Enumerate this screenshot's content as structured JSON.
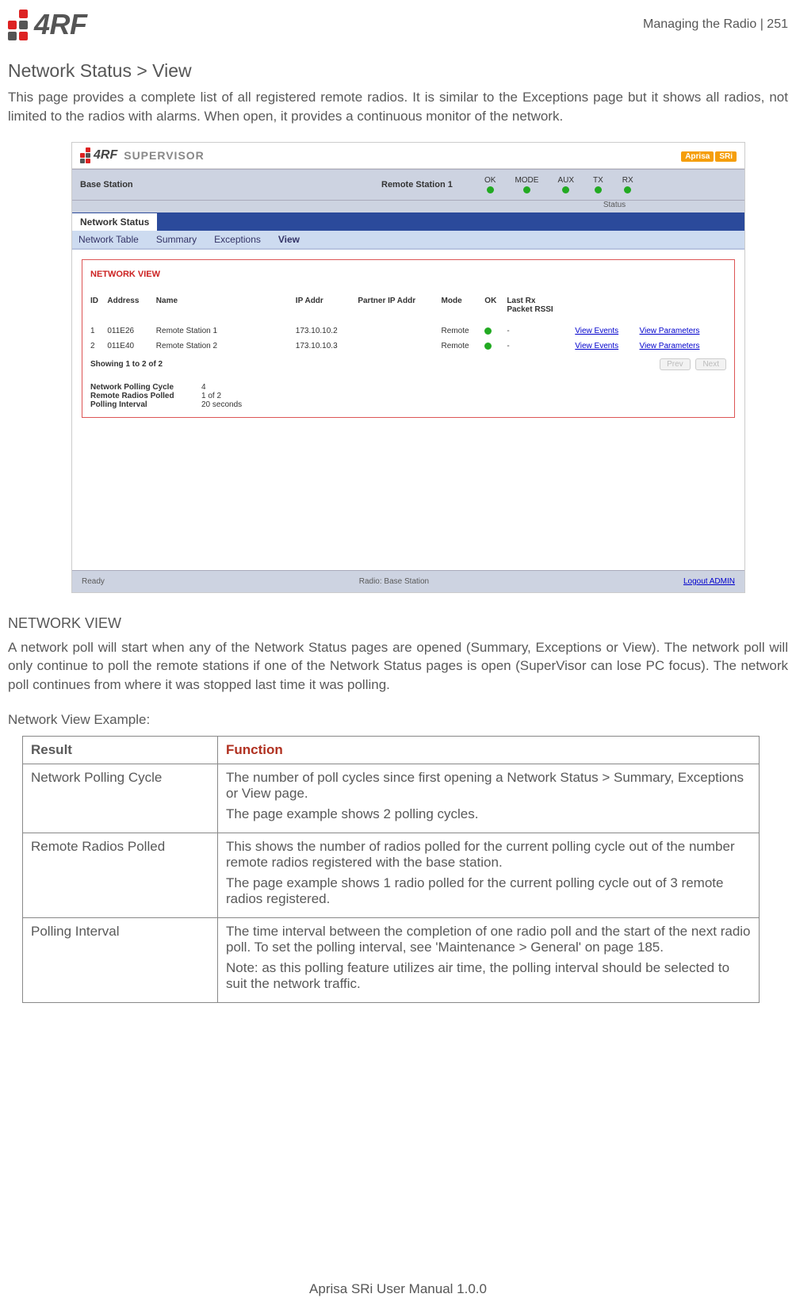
{
  "header": {
    "logo_text": "4RF",
    "right": "Managing the Radio  |  251"
  },
  "section": {
    "title": "Network Status > View",
    "intro": "This page provides a complete list of all registered remote radios. It is similar to the Exceptions page but it shows all radios, not limited to the radios with alarms. When open, it provides a continuous monitor of the network."
  },
  "supervisor": {
    "logo_text": "4RF",
    "sup": "SUPERVISOR",
    "brand": "Aprisa",
    "brand_badge": "SRi",
    "base": "Base Station",
    "remote": "Remote Station 1",
    "leds": [
      "OK",
      "MODE",
      "AUX",
      "TX",
      "RX"
    ],
    "status_label": "Status",
    "tab": "Network Status",
    "subtabs": {
      "a": "Network Table",
      "b": "Summary",
      "c": "Exceptions",
      "d": "View"
    },
    "panel_title": "NETWORK VIEW",
    "cols": {
      "id": "ID",
      "addr": "Address",
      "name": "Name",
      "ip": "IP Addr",
      "pip": "Partner IP Addr",
      "mode": "Mode",
      "ok": "OK",
      "rssi": "Last Rx\nPacket RSSI"
    },
    "rows": [
      {
        "id": "1",
        "addr": "011E26",
        "name": "Remote Station 1",
        "ip": "173.10.10.2",
        "pip": "",
        "mode": "Remote",
        "ok": "g",
        "rssi": "-",
        "ve": "View Events",
        "vp": "View Parameters"
      },
      {
        "id": "2",
        "addr": "011E40",
        "name": "Remote Station 2",
        "ip": "173.10.10.3",
        "pip": "",
        "mode": "Remote",
        "ok": "g",
        "rssi": "-",
        "ve": "View Events",
        "vp": "View Parameters"
      }
    ],
    "showing": "Showing 1 to 2 of 2",
    "prev": "Prev",
    "next": "Next",
    "stats": {
      "npc_k": "Network Polling Cycle",
      "npc_v": "4",
      "rrp_k": "Remote Radios Polled",
      "rrp_v": "1 of 2",
      "pi_k": "Polling Interval",
      "pi_v": "20 seconds"
    },
    "footer": {
      "ready": "Ready",
      "radio": "Radio: Base Station",
      "logout": "Logout ADMIN"
    }
  },
  "nv": {
    "title": "NETWORK VIEW",
    "para": "A network poll will start when any of the Network Status pages are opened (Summary, Exceptions or View). The network poll will only continue to poll the remote stations if one of the Network Status pages is open (SuperVisor can lose PC focus). The network poll continues from where it was stopped last time it was polling.",
    "ex_title": "Network View Example:"
  },
  "table": {
    "h1": "Result",
    "h2": "Function",
    "rows": [
      {
        "k": "Network Polling Cycle",
        "v1": "The number of poll cycles since first opening a Network Status > Summary, Exceptions or View page.",
        "v2": "The page example shows 2 polling cycles."
      },
      {
        "k": "Remote Radios Polled",
        "v1": "This shows the number of radios polled for the current polling cycle out of the number remote radios registered with the base station.",
        "v2": "The page example shows 1 radio polled for the current polling cycle out of 3 remote radios registered."
      },
      {
        "k": "Polling Interval",
        "v1": "The time interval between the completion of one radio poll and the start of the next radio poll. To set the polling interval, see 'Maintenance > General' on page 185.",
        "v2": "Note: as this polling feature utilizes air time, the polling interval should be selected to suit the network traffic."
      }
    ]
  },
  "footer": "Aprisa SRi User Manual 1.0.0"
}
